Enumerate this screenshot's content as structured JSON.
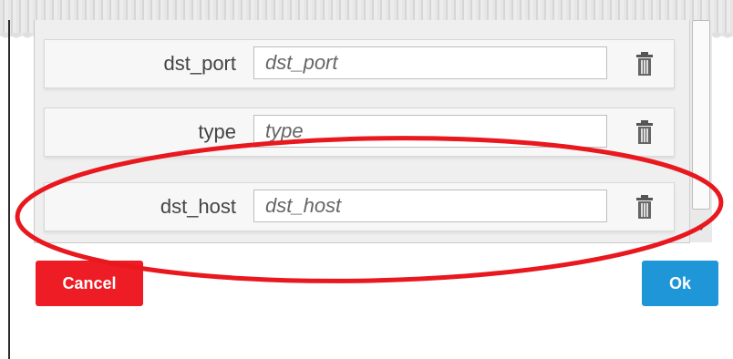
{
  "rows": [
    {
      "label": "dst_port",
      "placeholder": "dst_port",
      "delete_icon": "trash-icon"
    },
    {
      "label": "type",
      "placeholder": "type",
      "delete_icon": "trash-icon"
    },
    {
      "label": "dst_host",
      "placeholder": "dst_host",
      "delete_icon": "trash-icon"
    }
  ],
  "buttons": {
    "cancel_label": "Cancel",
    "ok_label": "Ok"
  },
  "colors": {
    "cancel": "#ee1c24",
    "ok": "#1f96d8",
    "annotation_ellipse": "#e8181e",
    "panel_background": "#efefef"
  },
  "annotation": {
    "shape": "ellipse",
    "highlights": "dst_host"
  }
}
